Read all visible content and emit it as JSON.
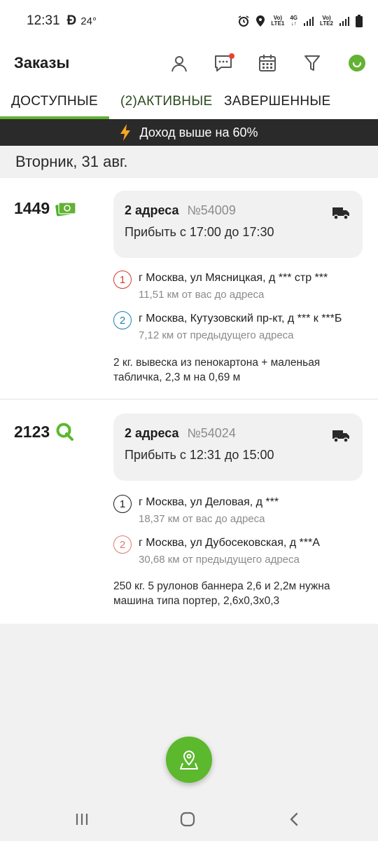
{
  "status_bar": {
    "time": "12:31",
    "app_glyph": "Ð",
    "temperature": "24°",
    "sim1": "LTE1",
    "sim2": "LTE2",
    "net": "4G"
  },
  "header": {
    "title": "Заказы"
  },
  "tabs": [
    {
      "label": "ДОСТУПНЫЕ",
      "active": true
    },
    {
      "label": "(2)АКТИВНЫЕ",
      "active": false
    },
    {
      "label": "ЗАВЕРШЕННЫЕ",
      "active": false
    }
  ],
  "banner": {
    "text": "Доход выше на 60%"
  },
  "date_header": "Вторник, 31 авг.",
  "orders": [
    {
      "price": "1449",
      "payment_icon": "cash-icon",
      "addresses_count": "2 адреса",
      "number": "№54009",
      "arrive": "Прибыть с 17:00 до 17:30",
      "stops": [
        {
          "index": "1",
          "address": "г Москва, ул Мясницкая, д *** стр ***",
          "distance": "11,51 км от вас до адреса",
          "color": "#d23a2e"
        },
        {
          "index": "2",
          "address": "г Москва, Кутузовский пр-кт, д *** к ***Б",
          "distance": "7,12 км от предыдущего адреса",
          "color": "#1f7fb0"
        }
      ],
      "description": "2 кг. вывеска из пенокартона + маленьая табличка, 2,3 м на 0,69 м"
    },
    {
      "price": "2123",
      "payment_icon": "qiwi-icon",
      "addresses_count": "2 адреса",
      "number": "№54024",
      "arrive": "Прибыть с 12:31 до 15:00",
      "stops": [
        {
          "index": "1",
          "address": "г Москва, ул Деловая, д ***",
          "distance": "18,37 км от вас до адреса",
          "color": "#1d1d1d"
        },
        {
          "index": "2",
          "address": "г Москва, ул Дубосековская, д ***А",
          "distance": "30,68 км от предыдущего адреса",
          "color": "#e07a72"
        }
      ],
      "description": "250 кг. 5 рулонов баннера 2,6 и 2,2м нужна машина типа портер, 2,6x0,3x0,3"
    }
  ],
  "colors": {
    "accent": "#63b233",
    "fab": "#5cb82d",
    "banner_bg": "#2a2a2a",
    "bolt": "#f5a623"
  }
}
